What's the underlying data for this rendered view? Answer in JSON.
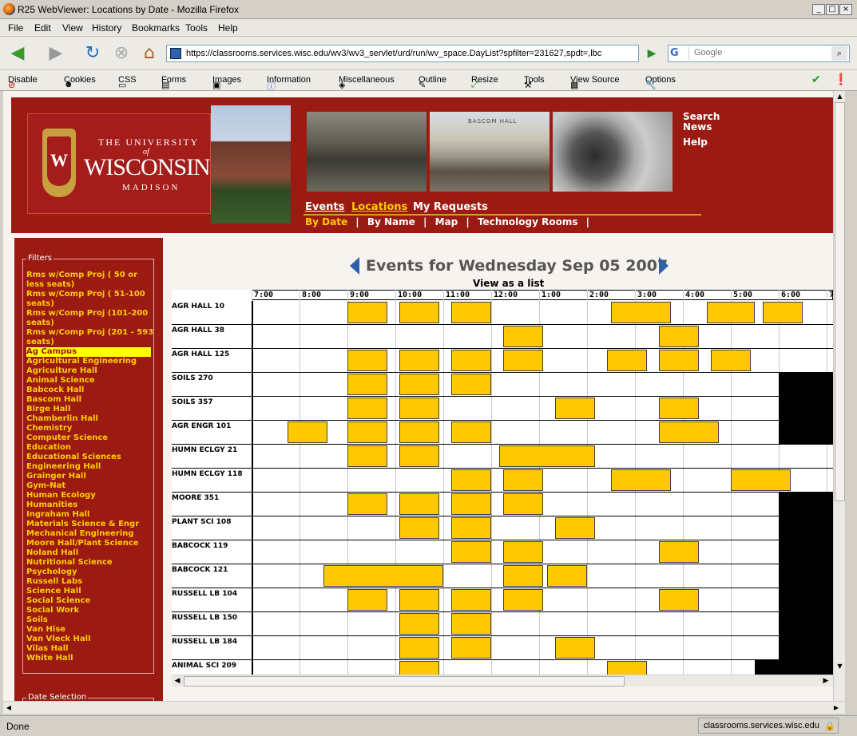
{
  "window": {
    "title": "R25 WebViewer: Locations by Date - Mozilla Firefox"
  },
  "menu": [
    "File",
    "Edit",
    "View",
    "History",
    "Bookmarks",
    "Tools",
    "Help"
  ],
  "address": {
    "url": "https://classrooms.services.wisc.edu/wv3/wv3_servlet/urd/run/wv_space.DayList?spfilter=231627,spdt=,lbc"
  },
  "search": {
    "placeholder": "Google"
  },
  "devtoolbar": [
    "Disable",
    "Cookies",
    "CSS",
    "Forms",
    "Images",
    "Information",
    "Miscellaneous",
    "Outline",
    "Resize",
    "Tools",
    "View Source",
    "Options"
  ],
  "banner": {
    "university_top": "THE UNIVERSITY",
    "university_of": "of",
    "university_name": "WISCONSIN",
    "university_campus": "MADISON",
    "photo_caption": "BASCOM HALL",
    "side_links": [
      "Search",
      "News",
      "Help"
    ],
    "main_tabs": [
      "Events",
      "Locations",
      "My Requests"
    ],
    "sub_tabs": [
      "By Date",
      "By Name",
      "Map",
      "Technology Rooms"
    ],
    "sub_sep": "|"
  },
  "filters": {
    "legend": "Filters",
    "items": [
      "Rms w/Comp Proj ( 50 or less seats)",
      "Rms w/Comp Proj ( 51-100 seats)",
      "Rms w/Comp Proj (101-200 seats)",
      "Rms w/Comp Proj (201 - 593 seats)",
      "Ag Campus",
      "Agricultural Engineering",
      "Agriculture Hall",
      "Animal Science",
      "Babcock Hall",
      "Bascom Hall",
      "Birge Hall",
      "Chamberlin Hall",
      "Chemistry",
      "Computer Science",
      "Education",
      "Educational Sciences",
      "Engineering Hall",
      "Grainger Hall",
      "Gym-Nat",
      "Human Ecology",
      "Humanities",
      "Ingraham Hall",
      "Materials Science & Engr",
      "Mechanical Engineering",
      "Moore Hall/Plant Science",
      "Noland Hall",
      "Nutritional Science",
      "Psychology",
      "Russell Labs",
      "Science Hall",
      "Social Science",
      "Social Work",
      "Soils",
      "Van Hise",
      "Van Vleck Hall",
      "Vilas Hall",
      "White Hall"
    ],
    "selected_index": 4,
    "date_legend": "Date Selection"
  },
  "schedule": {
    "title": "Events for Wednesday Sep 05 2007",
    "view_list": "View as a list",
    "times": [
      "7:00",
      "8:00",
      "9:00",
      "10:00",
      "11:00",
      "12:00",
      "1:00",
      "2:00",
      "3:00",
      "4:00",
      "5:00",
      "6:00",
      "7"
    ],
    "rows": [
      {
        "room": "AGR HALL 10",
        "events": [
          [
            9.0,
            9.83
          ],
          [
            10.08,
            10.92
          ],
          [
            11.17,
            12.0
          ],
          [
            14.5,
            15.75
          ],
          [
            16.5,
            17.5
          ],
          [
            17.67,
            18.5
          ]
        ],
        "black": []
      },
      {
        "room": "AGR HALL 38",
        "events": [
          [
            12.25,
            13.08
          ],
          [
            15.5,
            16.33
          ]
        ],
        "black": []
      },
      {
        "room": "AGR HALL 125",
        "events": [
          [
            9.0,
            9.83
          ],
          [
            10.08,
            10.92
          ],
          [
            11.17,
            12.0
          ],
          [
            12.25,
            13.08
          ],
          [
            14.42,
            15.25
          ],
          [
            15.5,
            16.33
          ],
          [
            16.58,
            17.42
          ]
        ],
        "black": []
      },
      {
        "room": "SOILS 270",
        "events": [
          [
            9.0,
            9.83
          ],
          [
            10.08,
            10.92
          ],
          [
            11.17,
            12.0
          ]
        ],
        "black": [
          [
            18.0,
            19.17
          ]
        ]
      },
      {
        "room": "SOILS 357",
        "events": [
          [
            9.0,
            9.83
          ],
          [
            10.08,
            10.92
          ],
          [
            13.33,
            14.17
          ],
          [
            15.5,
            16.33
          ]
        ],
        "black": [
          [
            18.0,
            19.17
          ]
        ]
      },
      {
        "room": "AGR ENGR 101",
        "events": [
          [
            7.75,
            8.58
          ],
          [
            9.0,
            9.83
          ],
          [
            10.08,
            10.92
          ],
          [
            11.17,
            12.0
          ],
          [
            15.5,
            16.75
          ]
        ],
        "black": [
          [
            18.0,
            19.17
          ]
        ]
      },
      {
        "room": "HUMN ECLGY 21",
        "events": [
          [
            9.0,
            9.83
          ],
          [
            10.08,
            10.92
          ],
          [
            12.17,
            14.17
          ]
        ],
        "black": []
      },
      {
        "room": "HUMN ECLGY 118",
        "events": [
          [
            11.17,
            12.0
          ],
          [
            12.25,
            13.08
          ],
          [
            14.5,
            15.75
          ],
          [
            17.0,
            18.25
          ]
        ],
        "black": []
      },
      {
        "room": "MOORE 351",
        "events": [
          [
            9.0,
            9.83
          ],
          [
            10.08,
            10.92
          ],
          [
            11.17,
            12.0
          ],
          [
            12.25,
            13.08
          ]
        ],
        "black": [
          [
            18.0,
            19.17
          ]
        ]
      },
      {
        "room": "PLANT SCI 108",
        "events": [
          [
            10.08,
            10.92
          ],
          [
            11.17,
            12.0
          ],
          [
            13.33,
            14.17
          ]
        ],
        "black": [
          [
            18.0,
            19.17
          ]
        ]
      },
      {
        "room": "BABCOCK 119",
        "events": [
          [
            11.17,
            12.0
          ],
          [
            12.25,
            13.08
          ],
          [
            15.5,
            16.33
          ]
        ],
        "black": [
          [
            18.0,
            19.17
          ]
        ]
      },
      {
        "room": "BABCOCK 121",
        "events": [
          [
            8.5,
            11.0
          ],
          [
            12.25,
            13.08
          ],
          [
            13.17,
            14.0
          ]
        ],
        "black": [
          [
            18.0,
            19.17
          ]
        ]
      },
      {
        "room": "RUSSELL LB 104",
        "events": [
          [
            9.0,
            9.83
          ],
          [
            10.08,
            10.92
          ],
          [
            11.17,
            12.0
          ],
          [
            12.25,
            13.08
          ],
          [
            15.5,
            16.33
          ]
        ],
        "black": [
          [
            18.0,
            19.17
          ]
        ]
      },
      {
        "room": "RUSSELL LB 150",
        "events": [
          [
            10.08,
            10.92
          ],
          [
            11.17,
            12.0
          ]
        ],
        "black": [
          [
            18.0,
            19.17
          ]
        ]
      },
      {
        "room": "RUSSELL LB 184",
        "events": [
          [
            10.08,
            10.92
          ],
          [
            11.17,
            12.0
          ],
          [
            13.33,
            14.17
          ]
        ],
        "black": [
          [
            18.0,
            19.17
          ]
        ]
      },
      {
        "room": "ANIMAL SCI 209",
        "events": [
          [
            10.08,
            10.92
          ],
          [
            14.42,
            15.25
          ]
        ],
        "black": [
          [
            17.5,
            19.17
          ]
        ]
      }
    ]
  },
  "status": {
    "left": "Done",
    "right": "classrooms.services.wisc.edu"
  },
  "colors": {
    "brand": "#9b1b13",
    "event": "#ffc800",
    "filter_text": "#ffcc00",
    "selected": "#ffff00"
  }
}
